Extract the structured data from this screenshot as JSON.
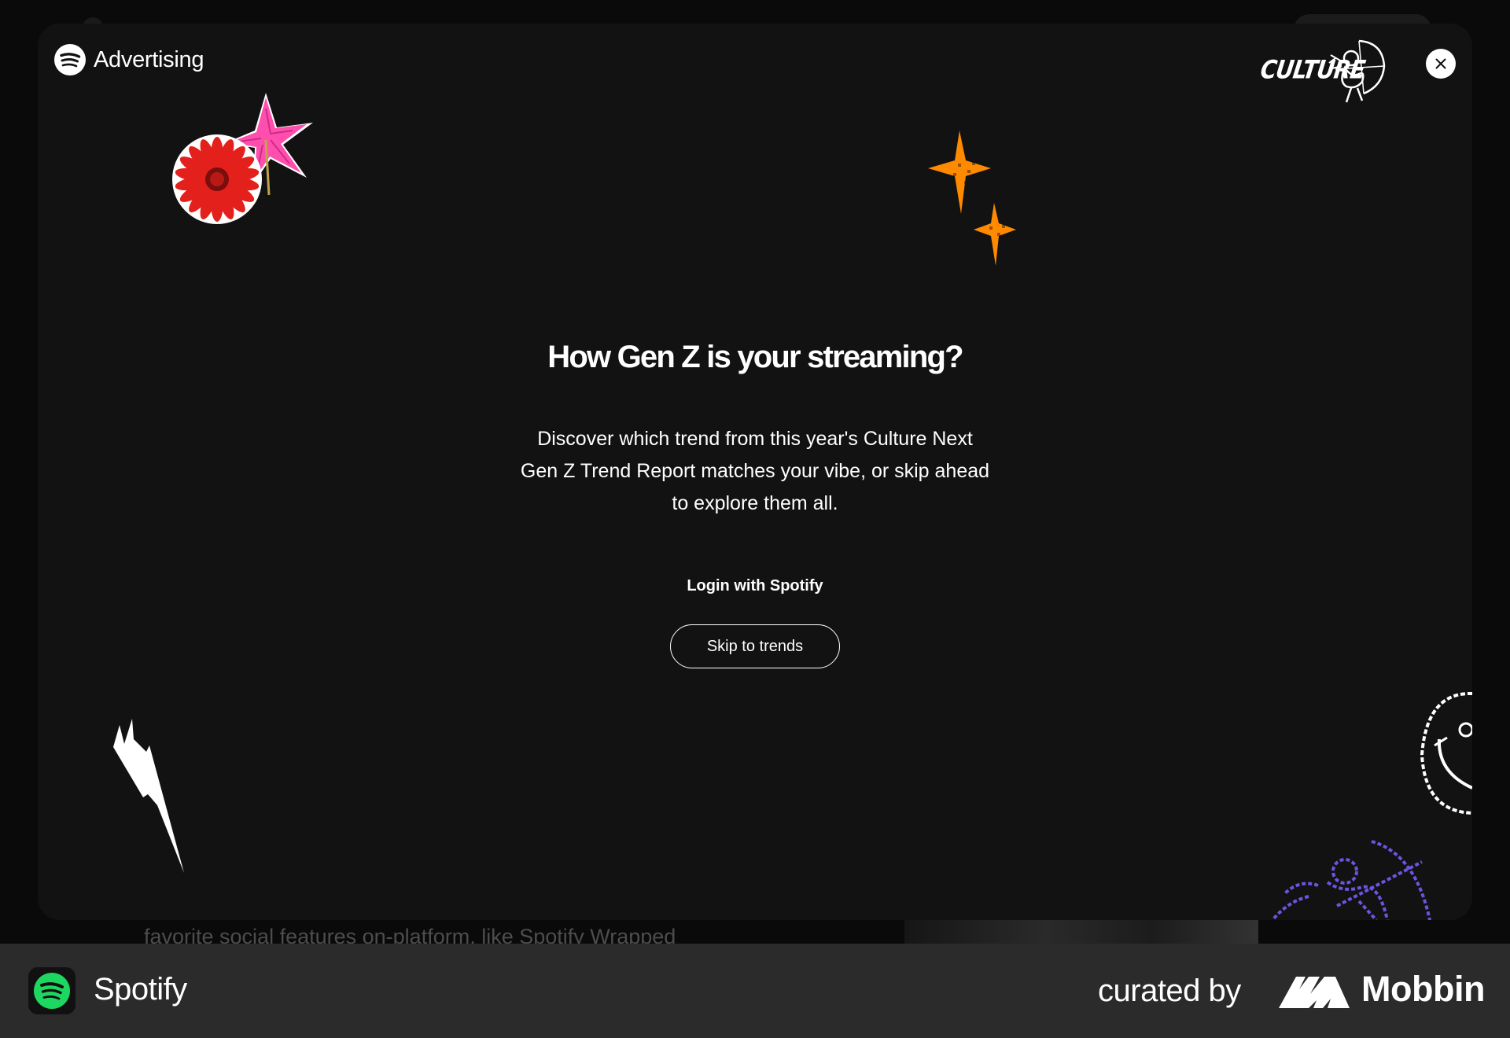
{
  "background": {
    "partial_text": "favorite social features on-platform, like Spotify Wrapped"
  },
  "modal": {
    "brand": {
      "label": "Advertising",
      "icon": "spotify-logo-icon"
    },
    "culture_logo": {
      "text": "CULTURE"
    },
    "close_button": {
      "icon": "close-icon"
    },
    "headline": "How Gen Z is your streaming?",
    "description_lines": [
      "Discover which trend from this year's Culture Next",
      "Gen Z Trend Report matches your vibe, or skip ahead",
      "to explore them all."
    ],
    "login_link": "Login with Spotify",
    "skip_button": "Skip to trends",
    "colors": {
      "modal_bg": "#121212",
      "flower_red": "#e3201b",
      "flower_pink": "#ff4fae",
      "sparkle_orange": "#ff8a00",
      "cupid_purple": "#6a55e0"
    }
  },
  "footer": {
    "app_name": "Spotify",
    "curated_by": "curated by",
    "brand": "Mobbin",
    "colors": {
      "spotify_green": "#1ed760"
    }
  }
}
